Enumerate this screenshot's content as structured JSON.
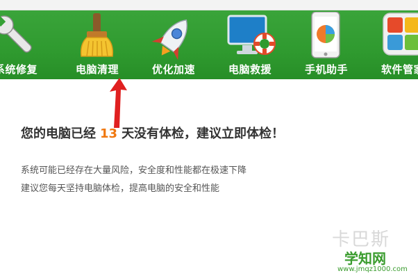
{
  "toolbar": {
    "items": [
      {
        "label": "系统修复",
        "icon": "wrench-icon"
      },
      {
        "label": "电脑清理",
        "icon": "broom-icon"
      },
      {
        "label": "优化加速",
        "icon": "rocket-icon"
      },
      {
        "label": "电脑救援",
        "icon": "monitor-lifebuoy-icon"
      },
      {
        "label": "手机助手",
        "icon": "phone-icon"
      },
      {
        "label": "软件管家",
        "icon": "software-grid-icon"
      }
    ],
    "background": "#2f9a2f"
  },
  "main": {
    "headline_prefix": "您的电脑已经",
    "days": "13",
    "headline_suffix": "天没有体检，建议立即体检！",
    "desc_line1": "系统可能已经存在大量风险，安全度和性能都在极速下降",
    "desc_line2": "建议您每天坚持电脑体检，提高电脑的安全和性能"
  },
  "watermark": {
    "faint_text": "卡巴斯",
    "site_text": "学知网",
    "url_text": "www.jmqz1000.com"
  },
  "colors": {
    "accent_days": "#f07810",
    "arrow": "#e02020",
    "watermark": "#3a9c2e"
  }
}
